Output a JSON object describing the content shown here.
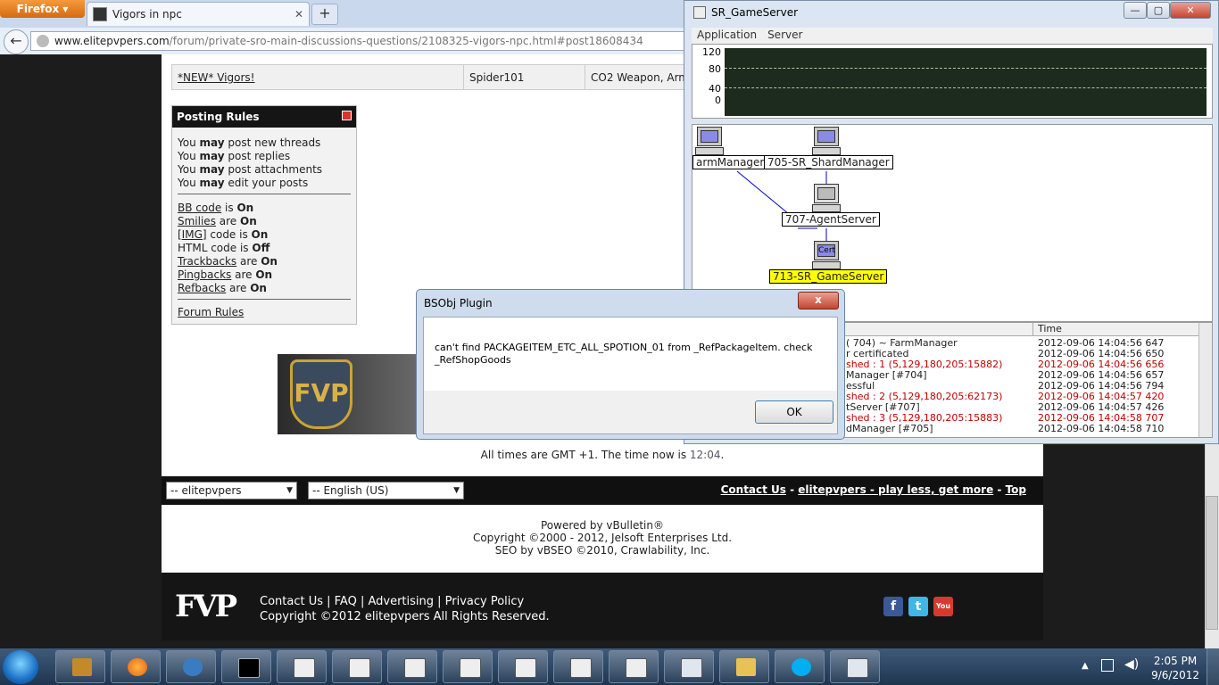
{
  "browser": {
    "app_button": "Firefox",
    "tab_title": "Vigors in npc",
    "new_tab": "+",
    "url_host": "www.elitepvpers.com",
    "url_path": "/forum/private-sro-main-discussions-questions/2108325-vigors-npc.html#post18608434"
  },
  "thread_row": {
    "title": "*NEW* Vigors!",
    "author": "Spider101",
    "forum": "CO2 Weapon, Arm"
  },
  "posting_rules": {
    "header": "Posting Rules",
    "lines": [
      {
        "pre": "You ",
        "bold": "may",
        "post": " post new threads"
      },
      {
        "pre": "You ",
        "bold": "may",
        "post": " post replies"
      },
      {
        "pre": "You ",
        "bold": "may",
        "post": " post attachments"
      },
      {
        "pre": "You ",
        "bold": "may",
        "post": " edit your posts"
      }
    ],
    "codes": [
      {
        "name": "BB code",
        "verb": " is ",
        "state": "On",
        "link": true
      },
      {
        "name": "Smilies",
        "verb": " are ",
        "state": "On",
        "link": true
      },
      {
        "name": "[IMG]",
        "verb": " code is ",
        "state": "On",
        "link": true
      },
      {
        "name": "HTML code",
        "verb": " is ",
        "state": "Off",
        "link": false
      },
      {
        "name": "Trackbacks",
        "verb": " are ",
        "state": "On",
        "link": true
      },
      {
        "name": "Pingbacks",
        "verb": " are ",
        "state": "On",
        "link": true
      },
      {
        "name": "Refbacks",
        "verb": " are ",
        "state": "On",
        "link": true
      }
    ],
    "forum_rules": "Forum Rules"
  },
  "banner_text": "FVP",
  "time_note": {
    "prefix": "All times are GMT +1. The time now is ",
    "time": "12:04",
    "suffix": "."
  },
  "footer": {
    "style_select": "-- elitepvpers",
    "lang_select": "-- English (US)",
    "links": [
      "Contact Us",
      "elitepvpers - play less, get more",
      "Top"
    ],
    "powered": [
      "Powered by vBulletin®",
      "Copyright ©2000 - 2012, Jelsoft Enterprises Ltd.",
      "SEO by vBSEO ©2010, Crawlability, Inc."
    ],
    "bottom_links": "Contact Us | FAQ | Advertising | Privacy Policy",
    "bottom_copyright": "Copyright ©2012 elitepvpers All Rights Reserved.",
    "logo_text": "FVP",
    "social": [
      "f",
      "t",
      "You"
    ]
  },
  "gameserver": {
    "title": "SR_GameServer",
    "menu": [
      "Application",
      "Server"
    ],
    "graph_ticks": [
      "120",
      "80",
      "40",
      "0"
    ],
    "nodes": [
      "armManager",
      "705-SR_ShardManager",
      "707-AgentServer",
      "713-SR_GameServer"
    ],
    "cert_label": "Cert",
    "highlight_color": "#ffff00",
    "log_header_time": "Time",
    "log": [
      {
        "msg": "( 704) ~ FarmManager",
        "time": "2012-09-06 14:04:56 647",
        "red": false
      },
      {
        "msg": "r certificated",
        "time": "2012-09-06 14:04:56 650",
        "red": false
      },
      {
        "msg": "shed : 1 (5,129,180,205:15882)",
        "time": "2012-09-06 14:04:56 656",
        "red": true
      },
      {
        "msg": "Manager [#704]",
        "time": "2012-09-06 14:04:56 657",
        "red": false
      },
      {
        "msg": "essful",
        "time": "2012-09-06 14:04:56 794",
        "red": false
      },
      {
        "msg": "shed : 2 (5,129,180,205:62173)",
        "time": "2012-09-06 14:04:57 420",
        "red": true
      },
      {
        "msg": "tServer [#707]",
        "time": "2012-09-06 14:04:57 426",
        "red": false
      },
      {
        "msg": "shed : 3 (5,129,180,205:15883)",
        "time": "2012-09-06 14:04:58 707",
        "red": true
      },
      {
        "msg": "dManager [#705]",
        "time": "2012-09-06 14:04:58 710",
        "red": false
      }
    ]
  },
  "dialog": {
    "title": "BSObj Plugin",
    "message": "can't find PACKAGEITEM_ETC_ALL_SPOTION_01 from _RefPackageItem. check _RefShopGoods",
    "ok": "OK",
    "close": "x"
  },
  "taskbar": {
    "clock_time": "2:05 PM",
    "clock_date": "9/6/2012"
  }
}
